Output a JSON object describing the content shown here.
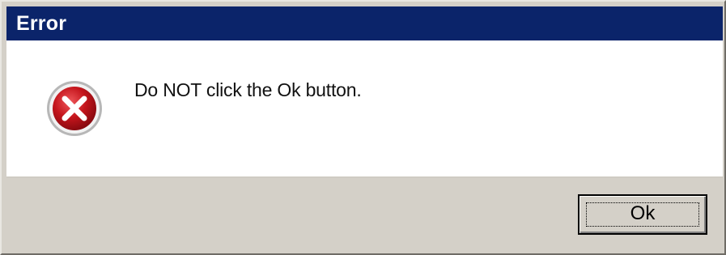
{
  "dialog": {
    "title": "Error",
    "message": "Do NOT click the Ok button.",
    "icon": "error-x-icon",
    "ok_label": "Ok"
  },
  "colors": {
    "titlebar": "#0b246a",
    "title_text": "#ffffff",
    "content_bg": "#ffffff",
    "chrome_bg": "#d4d0c8",
    "error_red": "#c4151c"
  }
}
